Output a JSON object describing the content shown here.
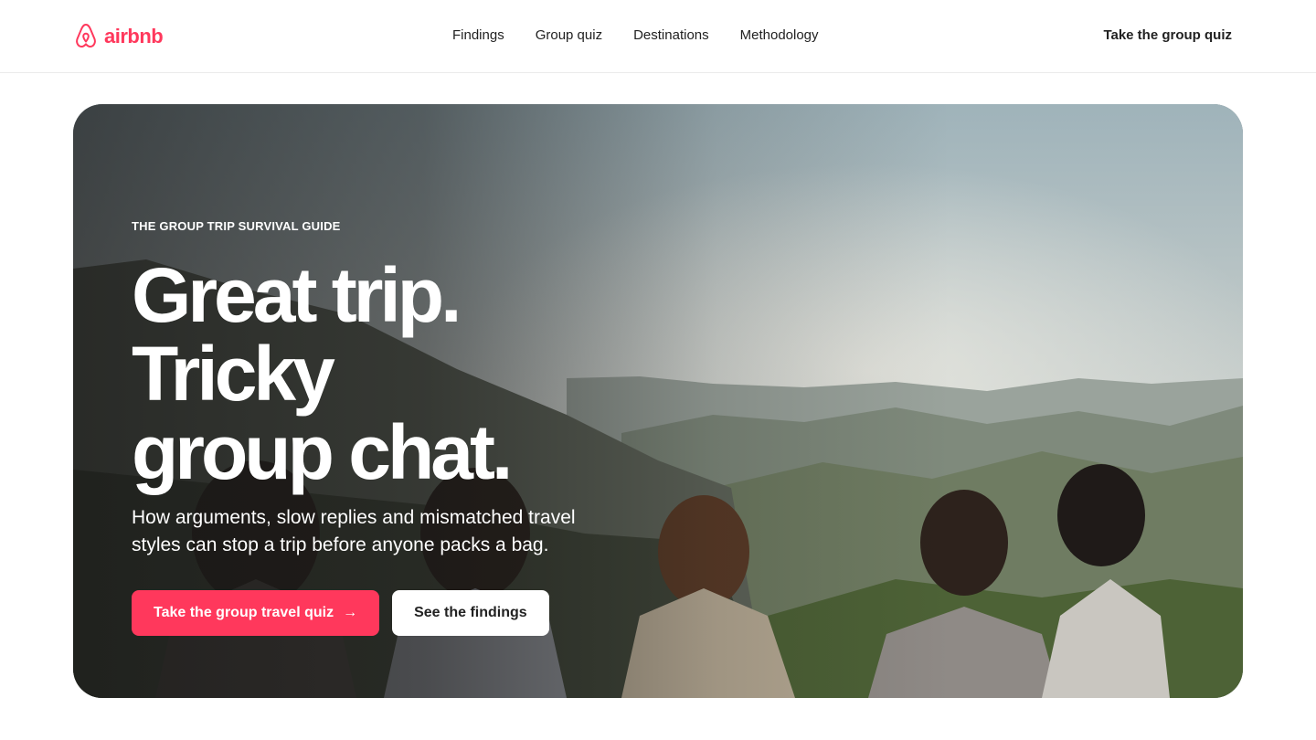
{
  "brand": {
    "name": "airbnb",
    "color": "#ff385c",
    "icon": "airbnb-belo-icon"
  },
  "nav": {
    "items": [
      {
        "label": "Findings"
      },
      {
        "label": "Group quiz"
      },
      {
        "label": "Destinations"
      },
      {
        "label": "Methodology"
      }
    ],
    "cta_label": "Take the group quiz"
  },
  "hero": {
    "eyebrow": "THE GROUP TRIP SURVIVAL GUIDE",
    "headline_lines": [
      "Great trip.",
      "Tricky",
      "group chat."
    ],
    "subtitle": "How arguments, slow replies and mismatched travel styles can stop a trip before anyone packs a bag.",
    "primary_button": {
      "label": "Take the group travel quiz",
      "icon": "arrow-right-icon",
      "glyph": "→"
    },
    "secondary_button": {
      "label": "See the findings"
    },
    "background": "photo of friends overlooking mountain valley"
  },
  "colors": {
    "accent": "#ff385c",
    "text": "#222222",
    "divider": "#ebebeb"
  }
}
